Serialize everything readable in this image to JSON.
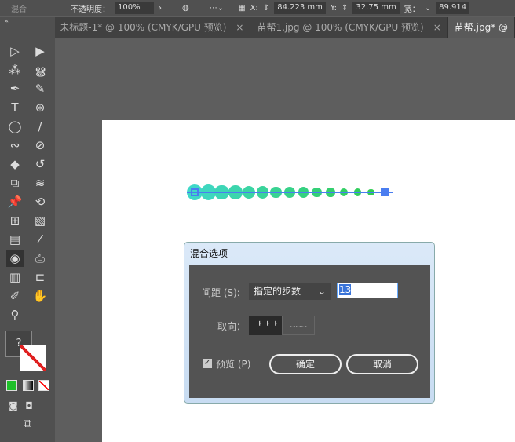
{
  "toolbar": {
    "mode": "混合",
    "opacity_label": "不透明度：",
    "opacity": "100%",
    "x_label": "X:",
    "x": "84.223 mm",
    "y_label": "Y:",
    "y": "32.75 mm",
    "w_label": "宽：",
    "w": "89.914"
  },
  "tabs": [
    {
      "label": "未标题-1* @ 100% (CMYK/GPU 预览)",
      "close": "×"
    },
    {
      "label": "苗帮1.jpg @ 100% (CMYK/GPU 预览)",
      "close": "×"
    },
    {
      "label": "苗帮.jpg* @",
      "close": ""
    }
  ],
  "blend": {
    "start_color": "#3fd8c8",
    "end_color": "#2ecc4a",
    "steps": 13,
    "anchor_color": "#4a7df0"
  },
  "dialog": {
    "title": "混合选项",
    "spacing_label": "间距 (S):",
    "spacing_value": "指定的步数",
    "steps_value": "13",
    "orientation_label": "取向：",
    "preview_label": "预览 (P)",
    "preview_checked": true,
    "ok": "确定",
    "cancel": "取消"
  },
  "tools": {
    "help": "?"
  }
}
